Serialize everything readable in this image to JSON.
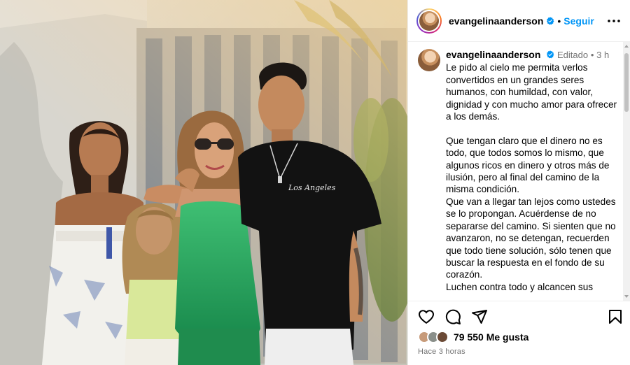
{
  "post": {
    "author": "evangelinaanderson",
    "follow_label": "Seguir",
    "dot": "•",
    "edited_label": "Editado",
    "time_short": "3 h",
    "caption": "Le pido al cielo me permita verlos convertidos en un grandes seres humanos, con humildad, con valor, dignidad y con mucho amor para ofrecer a los demás.\n\nQue tengan claro que el dinero no es todo, que todos somos lo mismo, que algunos ricos en dinero y otros más de ilusión, pero al final del camino de la misma condición.\nQue van a llegar tan lejos como ustedes se lo propongan. Acuérdense de no separarse del camino. Si sienten que no avanzaron, no se detengan, recuerden que todo tiene solución, sólo tenen que buscar la respuesta en el fondo de su corazón.\nLuchen contra todo y alcancen sus",
    "likes": "79 550 Me gusta",
    "timestamp": "Hace 3 horas"
  },
  "photo": {
    "shirt_print": "Los Angeles"
  },
  "icons": {
    "verified": "verified-badge-icon",
    "more": "more-options-icon",
    "like": "heart-icon",
    "comment": "comment-icon",
    "share": "share-icon",
    "save": "bookmark-icon"
  },
  "colors": {
    "accent": "#0095f6",
    "verified": "#0095f6",
    "muted": "#737373"
  }
}
